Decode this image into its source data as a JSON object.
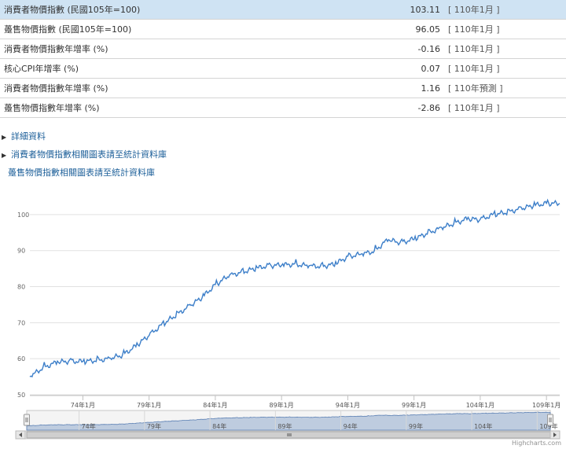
{
  "stats": [
    {
      "label": "消費者物價指數 (民國105年=100)",
      "value": "103.11",
      "period": "[ 110年1月 ]"
    },
    {
      "label": "躉售物價指數 (民國105年=100)",
      "value": "96.05",
      "period": "[ 110年1月 ]"
    },
    {
      "label": "消費者物價指數年增率 (%)",
      "value": "-0.16",
      "period": "[ 110年1月 ]"
    },
    {
      "label": "核心CPI年增率 (%)",
      "value": "0.07",
      "period": "[ 110年1月 ]"
    },
    {
      "label": "消費者物價指數年增率 (%)",
      "value": "1.16",
      "period": "[ 110年預測 ]"
    },
    {
      "label": "躉售物價指數年增率 (%)",
      "value": "-2.86",
      "period": "[ 110年1月 ]"
    }
  ],
  "links": {
    "detail": "詳細資料",
    "cpi_charts": "消費者物價指數相關圖表請至統計資料庫",
    "wpi_charts": "躉售物價指數相關圖表請至統計資料庫"
  },
  "credit": "Highcharts.com",
  "colors": {
    "line": "#3d7fc9",
    "grid": "#e1e1e1",
    "navigator_fill": "#b8c8dd"
  },
  "chart_data": {
    "type": "line",
    "title": "",
    "xlabel": "",
    "ylabel": "",
    "ylim": [
      50,
      105
    ],
    "yticks": [
      50,
      60,
      70,
      80,
      90,
      100
    ],
    "xticks": [
      "74年1月",
      "79年1月",
      "84年1月",
      "89年1月",
      "94年1月",
      "99年1月",
      "104年1月",
      "109年1月"
    ],
    "navigator_ticks": [
      "74年",
      "79年",
      "84年",
      "89年",
      "94年",
      "99年",
      "104年",
      "109年"
    ],
    "grid": true,
    "legend": "none",
    "x_period": "monthly, 民國70年1月–110年1月",
    "anchors": [
      {
        "x": "70年1月",
        "y": 55.0
      },
      {
        "x": "71年1月",
        "y": 57.5
      },
      {
        "x": "72年1月",
        "y": 59.0
      },
      {
        "x": "73年1月",
        "y": 59.3
      },
      {
        "x": "74年1月",
        "y": 59.2
      },
      {
        "x": "75年1月",
        "y": 59.5
      },
      {
        "x": "76年1月",
        "y": 60.0
      },
      {
        "x": "77年1月",
        "y": 61.0
      },
      {
        "x": "78年1月",
        "y": 63.5
      },
      {
        "x": "79年1月",
        "y": 66.5
      },
      {
        "x": "80年1月",
        "y": 69.5
      },
      {
        "x": "81年1月",
        "y": 72.0
      },
      {
        "x": "82年1月",
        "y": 74.5
      },
      {
        "x": "83年1月",
        "y": 77.0
      },
      {
        "x": "84年1月",
        "y": 80.5
      },
      {
        "x": "85年1月",
        "y": 83.0
      },
      {
        "x": "86年1月",
        "y": 84.0
      },
      {
        "x": "87年1月",
        "y": 85.0
      },
      {
        "x": "88年1月",
        "y": 85.8
      },
      {
        "x": "89年1月",
        "y": 86.0
      },
      {
        "x": "90年1月",
        "y": 86.2
      },
      {
        "x": "91年1月",
        "y": 85.8
      },
      {
        "x": "92年1月",
        "y": 85.6
      },
      {
        "x": "93年1月",
        "y": 86.2
      },
      {
        "x": "94年1月",
        "y": 88.3
      },
      {
        "x": "95年1月",
        "y": 89.0
      },
      {
        "x": "96年1月",
        "y": 89.8
      },
      {
        "x": "97年1月",
        "y": 93.0
      },
      {
        "x": "98年1月",
        "y": 92.2
      },
      {
        "x": "99年1月",
        "y": 93.2
      },
      {
        "x": "100年1月",
        "y": 94.8
      },
      {
        "x": "101年1月",
        "y": 96.2
      },
      {
        "x": "102年1月",
        "y": 97.5
      },
      {
        "x": "103年1月",
        "y": 98.8
      },
      {
        "x": "104年1月",
        "y": 98.6
      },
      {
        "x": "105年1月",
        "y": 100.0
      },
      {
        "x": "106年1月",
        "y": 100.6
      },
      {
        "x": "107年1月",
        "y": 101.6
      },
      {
        "x": "108年1月",
        "y": 102.5
      },
      {
        "x": "109年1月",
        "y": 103.1
      },
      {
        "x": "110年1月",
        "y": 103.11
      }
    ]
  }
}
